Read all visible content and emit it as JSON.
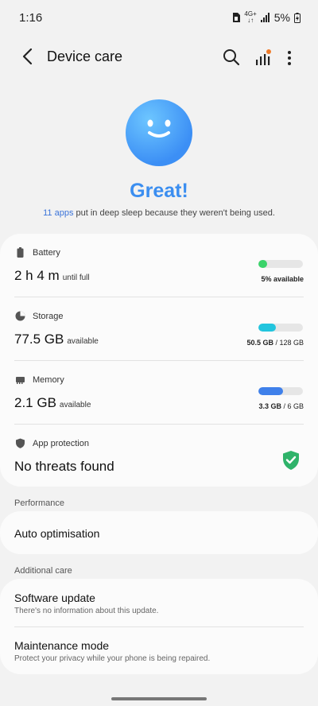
{
  "status_bar": {
    "time": "1:16",
    "network_top": "4G+",
    "network_bottom": "↓↑",
    "battery": "5%"
  },
  "app_bar": {
    "title": "Device care"
  },
  "hero": {
    "headline": "Great!",
    "link_text": "11 apps",
    "message": " put in deep sleep because they weren't being used."
  },
  "battery": {
    "label": "Battery",
    "value": "2 h 4 m",
    "unit": "until full",
    "note": "5% available",
    "level": 0.05,
    "color": "#3bd36a"
  },
  "storage": {
    "label": "Storage",
    "value": "77.5 GB",
    "unit": "available",
    "used": "50.5 GB",
    "total": " / 128 GB",
    "level": 0.39,
    "color": "#22c5de"
  },
  "memory": {
    "label": "Memory",
    "value": "2.1 GB",
    "unit": "available",
    "used": "3.3 GB",
    "total": " / 6 GB",
    "level": 0.55,
    "color": "#3f80ea"
  },
  "protection": {
    "label": "App protection",
    "value": "No threats found",
    "color": "#2fb36a"
  },
  "performance": {
    "section": "Performance",
    "item": "Auto optimisation"
  },
  "additional": {
    "section": "Additional care",
    "software_title": "Software update",
    "software_sub": "There's no information about this update.",
    "maintenance_title": "Maintenance mode",
    "maintenance_sub": "Protect your privacy while your phone is being repaired."
  },
  "icons": {
    "back": "back-arrow-icon",
    "search": "search-icon",
    "diagnostics": "signal-bars-icon",
    "more": "more-vert-icon"
  }
}
